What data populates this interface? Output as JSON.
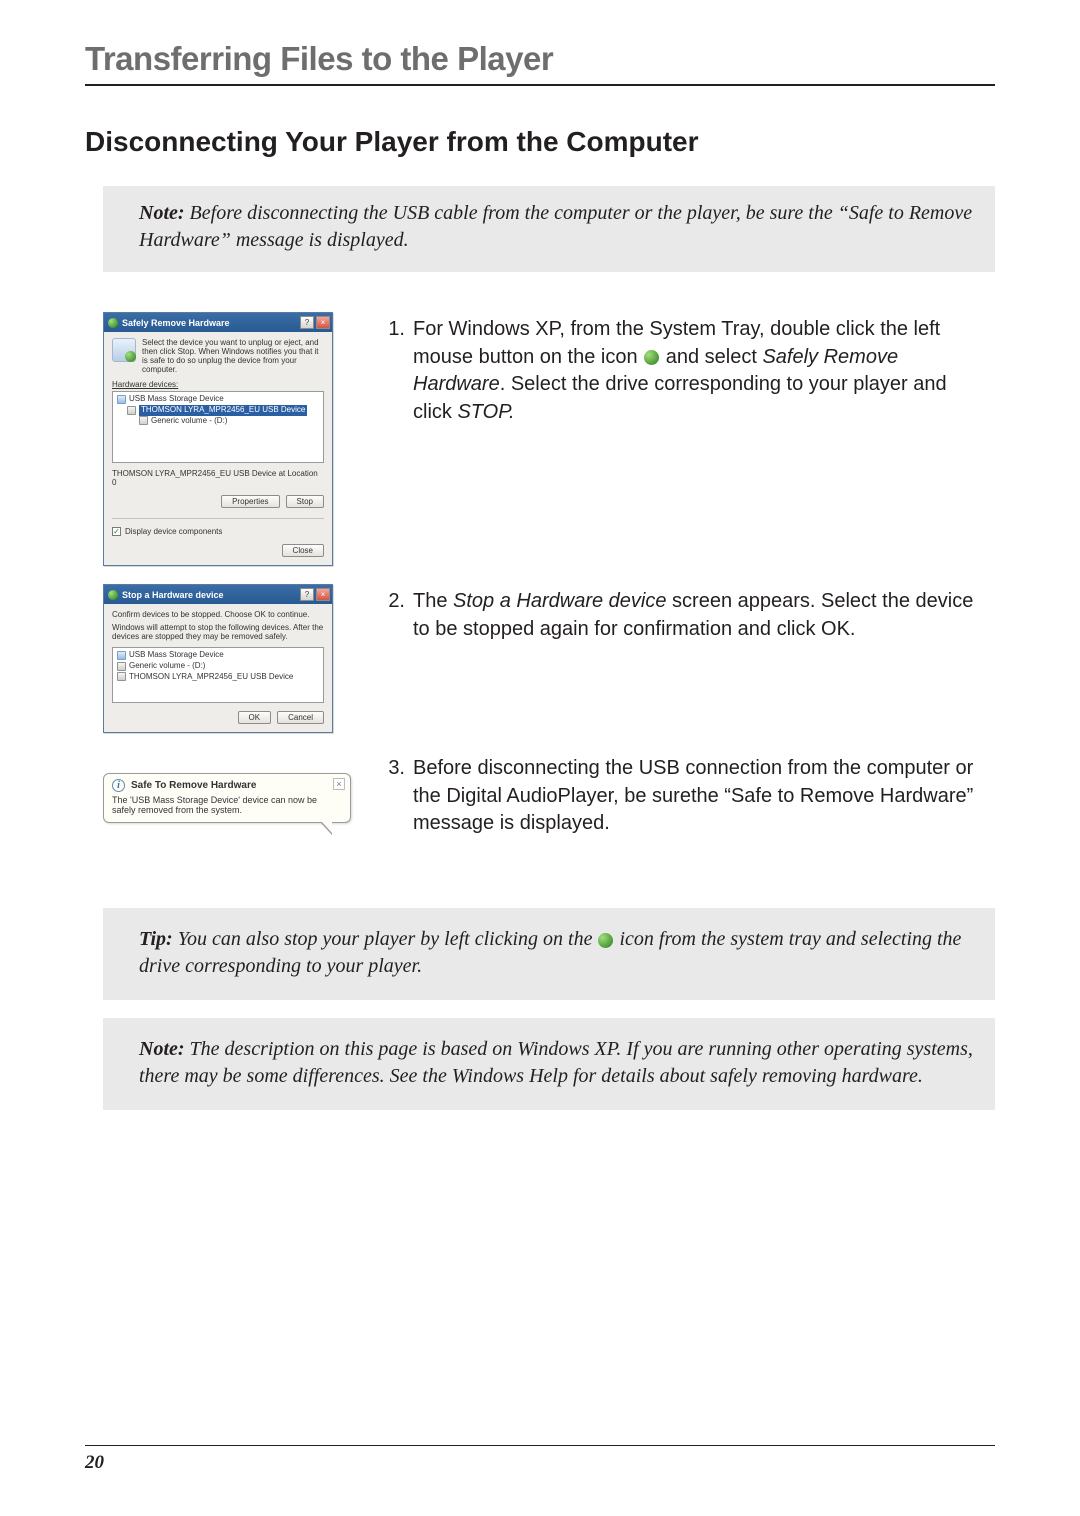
{
  "chapter_title": "Transferring Files to the Player",
  "section_title": "Disconnecting Your Player from the Computer",
  "top_note": {
    "lead": "Note:",
    "body": "Before disconnecting the USB cable from the computer or the player, be sure the “Safe to Remove Hardware” message is displayed."
  },
  "dialog1": {
    "title": "Safely Remove Hardware",
    "instructions": "Select the device you want to unplug or eject, and then click Stop. When Windows notifies you that it is safe to do so unplug the device from your computer.",
    "list_label": "Hardware devices:",
    "items": [
      "USB Mass Storage Device",
      "THOMSON LYRA_MPR2456_EU USB Device",
      "Generic volume - (D:)"
    ],
    "location_text": "THOMSON LYRA_MPR2456_EU USB Device at Location 0",
    "btn_properties": "Properties",
    "btn_stop": "Stop",
    "chk_label": "Display device components",
    "btn_close": "Close",
    "help_btn": "?",
    "x_btn": "×"
  },
  "dialog2": {
    "title": "Stop a Hardware device",
    "line1": "Confirm devices to be stopped. Choose OK to continue.",
    "line2": "Windows will attempt to stop the following devices. After the devices are stopped they may be removed safely.",
    "items": [
      "USB Mass Storage Device",
      "Generic volume - (D:)",
      "THOMSON LYRA_MPR2456_EU USB Device"
    ],
    "btn_ok": "OK",
    "btn_cancel": "Cancel",
    "help_btn": "?",
    "x_btn": "×"
  },
  "balloon": {
    "title": "Safe To Remove Hardware",
    "body": "The 'USB Mass Storage Device' device can now be safely removed from the system.",
    "info_glyph": "i",
    "x_btn": "×"
  },
  "steps": [
    {
      "num": "1.",
      "pre": "For Windows XP, from the System Tray, double click the left mouse button on the icon ",
      "mid": " and select ",
      "em": "Safely Remove Hardware",
      "post": ". Select the drive corresponding to your player and click ",
      "em2": "STOP."
    },
    {
      "num": "2.",
      "pre": "The ",
      "em": "Stop a Hardware device",
      "post": " screen appears. Select the device to be stopped again for confirmation and click OK."
    },
    {
      "num": "3.",
      "body": "Before disconnecting the USB connection from the computer or the Digital AudioPlayer, be surethe “Safe to Remove Hardware” message is displayed."
    }
  ],
  "tip": {
    "lead": "Tip:",
    "pre": "You can also stop your player by left clicking on the ",
    "post": " icon from the system tray and selecting the drive corresponding to your player."
  },
  "bottom_note": {
    "lead": "Note:",
    "body": "The description on this page is based on Windows XP. If you are running other operating systems, there may be some differences. See the Windows Help for details about safely removing hardware."
  },
  "page_number": "20"
}
